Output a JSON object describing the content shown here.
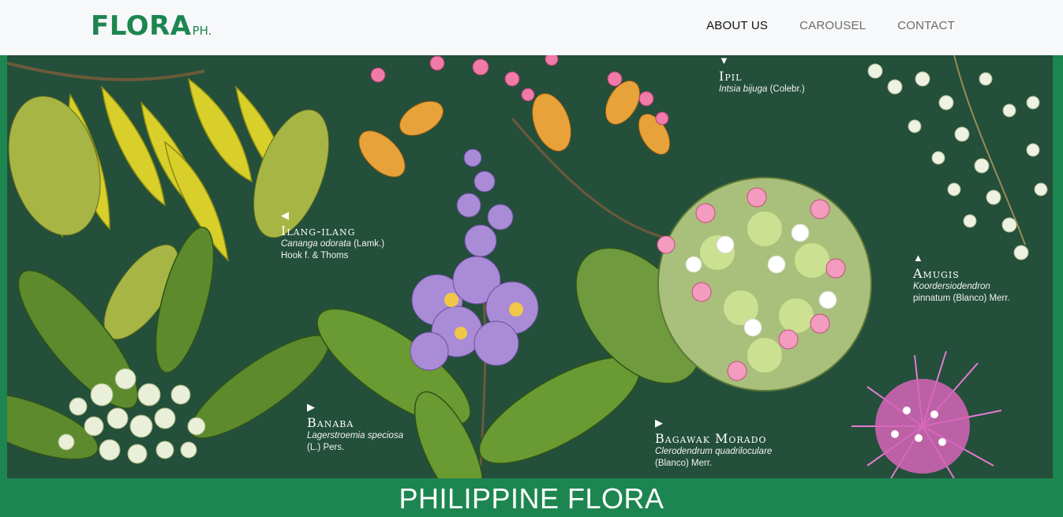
{
  "brand": {
    "main": "FLORA",
    "suffix": "PH."
  },
  "nav": {
    "items": [
      "ABOUT US",
      "CAROUSEL",
      "CONTACT"
    ],
    "active": "ABOUT US"
  },
  "hero": {
    "labels": [
      {
        "arrow": "▼",
        "name": "Ipil",
        "sci_italic": "Intsia bijuga",
        "sci_rest": " (Colebr.)",
        "line2": ""
      },
      {
        "arrow": "◀",
        "name": "Ilang-ilang",
        "sci_italic": "Cananga odorata",
        "sci_rest": " (Lamk.)",
        "line2": "Hook f. & Thoms"
      },
      {
        "arrow": "▲",
        "name": "Amugis",
        "sci_italic": "Koordersiodendron",
        "sci_rest": "",
        "line2": "pinnatum (Blanco) Merr."
      },
      {
        "arrow": "▶",
        "name": "Banaba",
        "sci_italic": "Lagerstroemia speciosa",
        "sci_rest": "",
        "line2": "(L.) Pers."
      },
      {
        "arrow": "▶",
        "name": "Bagawak Morado",
        "sci_italic": "Clerodendrum quadriloculare",
        "sci_rest": "",
        "line2": "(Blanco) Merr."
      }
    ]
  },
  "page_title": "PHILIPPINE FLORA",
  "colors": {
    "brand": "#1d8650",
    "hero_bg": "#234f3b",
    "navbar_bg": "#f7f8fa"
  }
}
